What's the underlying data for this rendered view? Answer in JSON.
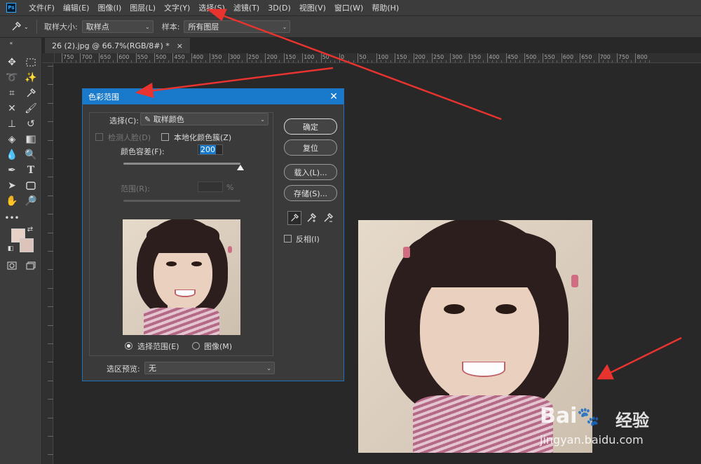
{
  "app": {
    "logo_text": "Ps"
  },
  "menu": [
    "文件(F)",
    "编辑(E)",
    "图像(I)",
    "图层(L)",
    "文字(Y)",
    "选择(S)",
    "滤镜(T)",
    "3D(D)",
    "视图(V)",
    "窗口(W)",
    "帮助(H)"
  ],
  "options_bar": {
    "sample_size_label": "取样大小:",
    "sample_size_value": "取样点",
    "sample_label": "样本:",
    "sample_value": "所有图层"
  },
  "document": {
    "tab_title": "26 (2).jpg @ 66.7%(RGB/8#) *",
    "close_glyph": "×"
  },
  "ruler": {
    "h_ticks": [
      "750",
      "700",
      "650",
      "600",
      "550",
      "500",
      "450",
      "400",
      "350",
      "300",
      "250",
      "200",
      "150",
      "100",
      "50",
      "0",
      "50",
      "100",
      "150",
      "200",
      "250",
      "300",
      "350",
      "400",
      "450",
      "500",
      "550",
      "600",
      "650",
      "700",
      "750",
      "800"
    ]
  },
  "dialog": {
    "title": "色彩范围",
    "close_glyph": "✕",
    "select_label": "选择(C):",
    "select_value": "取样颜色",
    "detect_faces_label": "检测人脸(D)",
    "localized_label": "本地化颜色簇(Z)",
    "fuzziness_label": "颜色容差(F):",
    "fuzziness_value": "200",
    "fuzziness_fraction": 1.0,
    "range_label": "范围(R):",
    "range_unit": "%",
    "radio_selection_label": "选择范围(E)",
    "radio_image_label": "图像(M)",
    "preview_label": "选区预览:",
    "preview_value": "无",
    "buttons": {
      "ok": "确定",
      "reset": "复位",
      "load": "载入(L)...",
      "save": "存储(S)..."
    },
    "invert_label": "反相(I)"
  },
  "watermark": {
    "baidu": "Bai",
    "jingyan": "经验",
    "url": "jingyan.baidu.com"
  },
  "colors": {
    "accent": "#1979ca",
    "arrow": "#e8332f",
    "foreground_swatch": "#e8d2c8",
    "background_swatch": "#dcc4bb"
  }
}
